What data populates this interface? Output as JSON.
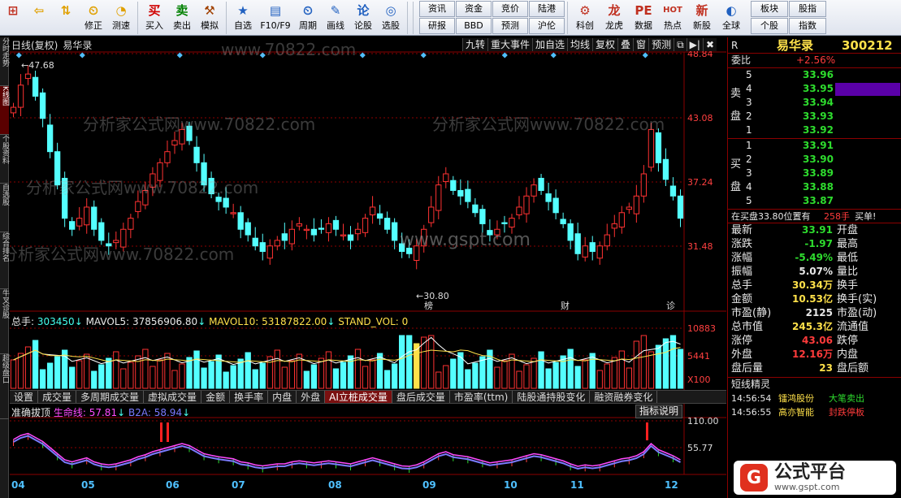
{
  "toolbar": {
    "left": [
      {
        "name": "home",
        "icon": "⊞",
        "label": "",
        "color": "#c03020"
      },
      {
        "name": "back",
        "icon": "⇦",
        "label": "",
        "color": "#e0a000"
      },
      {
        "name": "up-down",
        "icon": "⇅",
        "label": "",
        "color": "#e0a000"
      },
      {
        "name": "fix",
        "icon": "⏲",
        "label": "修正",
        "color": "#e0a000"
      },
      {
        "name": "speed",
        "icon": "◔",
        "label": "测速",
        "color": "#e0a000"
      },
      {
        "name": "buy",
        "icon": "买",
        "label": "买入",
        "color": "#d00000"
      },
      {
        "name": "sell",
        "icon": "卖",
        "label": "卖出",
        "color": "#008000"
      },
      {
        "name": "simulate",
        "icon": "⚒",
        "label": "模拟",
        "color": "#a04000"
      },
      {
        "name": "watchlist",
        "icon": "★",
        "label": "自选",
        "color": "#2060c0"
      },
      {
        "name": "f10",
        "icon": "▤",
        "label": "F10/F9",
        "color": "#2060c0"
      },
      {
        "name": "period",
        "icon": "⏲",
        "label": "周期",
        "color": "#2060c0"
      },
      {
        "name": "draw",
        "icon": "✎",
        "label": "画线",
        "color": "#2060c0"
      },
      {
        "name": "discuss",
        "icon": "论",
        "label": "论股",
        "color": "#2060c0"
      },
      {
        "name": "pick",
        "icon": "◎",
        "label": "选股",
        "color": "#2060c0"
      }
    ],
    "grid": [
      "资讯",
      "资金",
      "竞价",
      "陆港",
      "研报",
      "BBD",
      "预测",
      "沪伦"
    ],
    "right": [
      {
        "name": "tech",
        "icon": "⚙",
        "label": "科创",
        "color": "#c03020"
      },
      {
        "name": "dragon",
        "icon": "龙",
        "label": "龙虎",
        "color": "#c03020"
      },
      {
        "name": "data",
        "icon": "PE",
        "label": "数据",
        "color": "#c03020"
      },
      {
        "name": "hot",
        "icon": "HOT",
        "label": "热点",
        "color": "#c03020"
      },
      {
        "name": "new-stock",
        "icon": "新",
        "label": "新股",
        "color": "#c03020"
      },
      {
        "name": "global",
        "icon": "◐",
        "label": "全球",
        "color": "#2060c0"
      }
    ],
    "grid2": [
      "板块",
      "股指",
      "个股",
      "指数"
    ]
  },
  "left_tabs": [
    "分时走势",
    "K线图",
    "个股资料",
    "自选股",
    "综合排名",
    "牛叉诊股",
    "超级盘口"
  ],
  "chart": {
    "title": "日线(复权)",
    "name": "易华录",
    "buttons": [
      "九转",
      "重大事件",
      "加自选",
      "均线",
      "复权",
      "叠",
      "窗",
      "预测",
      "⧉",
      "▶|",
      "✖"
    ],
    "price_axis": [
      "48.84",
      "43.08",
      "37.24",
      "31.48"
    ],
    "high_label": "47.68",
    "low_label": "30.80",
    "markers": [
      "榜",
      "财",
      "诊"
    ],
    "watermarks": [
      "www.70822.com",
      "分析家公式网www.70822.com",
      "分析家公式网www.70822.com",
      "www.gspt.com"
    ],
    "date_labels": [
      "04",
      "05",
      "06",
      "07",
      "08",
      "09",
      "10",
      "11",
      "12"
    ]
  },
  "volume": {
    "label": "总手:",
    "value": "303450",
    "ma5_label": "MAVOL5:",
    "ma5": "37856906.80",
    "ma10_label": "MAVOL10:",
    "ma10": "53187822.00",
    "std_label": "STAND_VOL:",
    "std": "0",
    "axis": [
      "10883",
      "5441",
      "X100"
    ]
  },
  "indicator_tabs": [
    "设置",
    "成交量",
    "多周期成交量",
    "虚拟成交量",
    "金额",
    "换手率",
    "内盘",
    "外盘",
    "AI立桩成交量",
    "盘后成交量",
    "市盈率(ttm)",
    "陆股通持股变化",
    "融资融券变化"
  ],
  "indicator": {
    "name": "准确拔顶",
    "life_label": "生命线:",
    "life": "57.81",
    "b2a_label": "B2A:",
    "b2a": "58.94",
    "explain": "指标说明",
    "axis": [
      "110.00",
      "55.77"
    ]
  },
  "quote": {
    "r_label": "R",
    "name": "易华录",
    "code": "300212",
    "webi_label": "委比",
    "webi": "+2.56%",
    "sell_label": "卖盘",
    "buy_label": "买盘",
    "asks": [
      {
        "n": "5",
        "p": "33.96",
        "v": ""
      },
      {
        "n": "4",
        "p": "33.95",
        "v": ""
      },
      {
        "n": "3",
        "p": "33.94",
        "v": ""
      },
      {
        "n": "2",
        "p": "33.93",
        "v": ""
      },
      {
        "n": "1",
        "p": "33.92",
        "v": ""
      }
    ],
    "bids": [
      {
        "n": "1",
        "p": "33.91",
        "v": ""
      },
      {
        "n": "2",
        "p": "33.90",
        "v": ""
      },
      {
        "n": "3",
        "p": "33.89",
        "v": ""
      },
      {
        "n": "4",
        "p": "33.88",
        "v": ""
      },
      {
        "n": "5",
        "p": "33.87",
        "v": ""
      }
    ],
    "trade_line": "在买盘33.80位置有",
    "trade_vol": "258手",
    "trade_act": "买单!",
    "stats": [
      {
        "l": "最新",
        "v": "33.91",
        "c": "grn",
        "l2": "开盘",
        "v2": ""
      },
      {
        "l": "涨跌",
        "v": "-1.97",
        "c": "grn",
        "l2": "最高",
        "v2": ""
      },
      {
        "l": "涨幅",
        "v": "-5.49%",
        "c": "grn",
        "l2": "最低",
        "v2": ""
      },
      {
        "l": "振幅",
        "v": "5.07%",
        "c": "wht",
        "l2": "量比",
        "v2": ""
      },
      {
        "l": "总手",
        "v": "30.34万",
        "c": "yel",
        "l2": "换手",
        "v2": ""
      },
      {
        "l": "金额",
        "v": "10.53亿",
        "c": "yel",
        "l2": "换手(实)",
        "v2": ""
      },
      {
        "l": "市盈(静)",
        "v": "2125",
        "c": "wht",
        "l2": "市盈(动)",
        "v2": ""
      },
      {
        "l": "总市值",
        "v": "245.3亿",
        "c": "yel",
        "l2": "流通值",
        "v2": ""
      },
      {
        "l": "涨停",
        "v": "43.06",
        "c": "red",
        "l2": "跌停",
        "v2": ""
      },
      {
        "l": "外盘",
        "v": "12.16万",
        "c": "red",
        "l2": "内盘",
        "v2": ""
      },
      {
        "l": "盘后量",
        "v": "23",
        "c": "yel",
        "l2": "盘后额",
        "v2": ""
      }
    ],
    "elves_title": "短线精灵",
    "elves": [
      {
        "t": "14:56:54",
        "n": "镭鸿股份",
        "e": "大笔卖出"
      },
      {
        "t": "14:56:55",
        "n": "高亦智能",
        "e": "封跌停板"
      }
    ]
  },
  "badge": {
    "text": "公式平台",
    "url": "www.gspt.com"
  },
  "colors": {
    "up": "#ff3232",
    "down": "#54ffff",
    "ma": "#ffffff",
    "grid": "#8b0000"
  }
}
